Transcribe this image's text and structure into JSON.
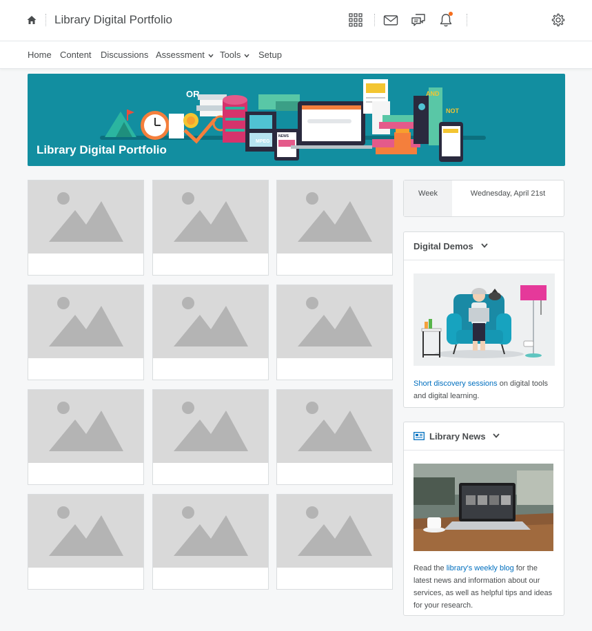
{
  "header": {
    "title": "Library Digital Portfolio",
    "icons": [
      "home-icon",
      "apps-grid-icon",
      "mail-icon",
      "chat-icon",
      "bell-icon",
      "gear-icon"
    ]
  },
  "nav": {
    "items": [
      {
        "label": "Home"
      },
      {
        "label": "Content"
      },
      {
        "label": "Discussions"
      },
      {
        "label": "Assessment",
        "dropdown": true
      },
      {
        "label": "Tools",
        "dropdown": true
      },
      {
        "label": "Setup"
      }
    ]
  },
  "banner": {
    "title": "Library Digital Portfolio"
  },
  "tiles": {
    "count": 12,
    "placeholder_icon": "image-placeholder-icon"
  },
  "calendar": {
    "view": "Week",
    "date": "Wednesday, April 21st"
  },
  "digital_demos": {
    "title": "Digital Demos",
    "link_text": "Short discovery sessions",
    "text_rest": " on digital tools and digital learning."
  },
  "library_news": {
    "title": "Library News",
    "text_before": "Read the ",
    "link_text": "library's weekly blog",
    "text_after": " for the latest news and information about our services, as well as helpful tips and ideas for your research."
  },
  "colors": {
    "banner": "#128ea0",
    "link": "#006fbf",
    "notification": "#f56e1e",
    "placeholder": "#d9d9d9"
  }
}
